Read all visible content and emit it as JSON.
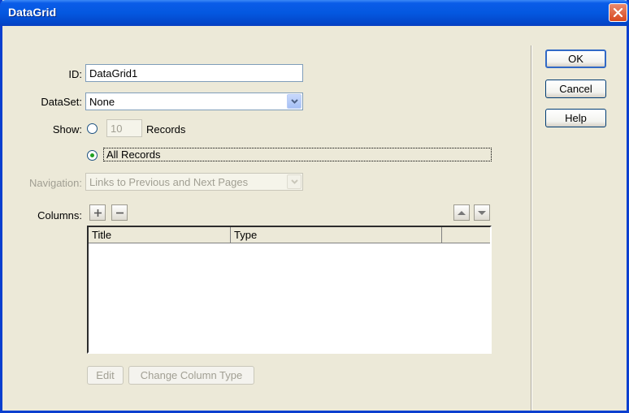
{
  "window": {
    "title": "DataGrid"
  },
  "form": {
    "id_label": "ID:",
    "id_value": "DataGrid1",
    "dataset_label": "DataSet:",
    "dataset_value": "None",
    "show_label": "Show:",
    "records_count": "10",
    "records_label": "Records",
    "all_records_label": "All Records",
    "show_selected": "All Records",
    "navigation_label": "Navigation:",
    "navigation_value": "Links to Previous and Next Pages",
    "columns_label": "Columns:"
  },
  "grid": {
    "columns": [
      "Title",
      "Type",
      ""
    ],
    "rows": []
  },
  "buttons": {
    "ok": "OK",
    "cancel": "Cancel",
    "help": "Help",
    "edit": "Edit",
    "change_column_type": "Change Column Type"
  },
  "icons": {
    "add": "plus-icon",
    "remove": "minus-icon",
    "move_up": "up-arrow-icon",
    "move_down": "down-arrow-icon",
    "close": "close-x-icon",
    "dropdown": "chevron-down-icon"
  }
}
